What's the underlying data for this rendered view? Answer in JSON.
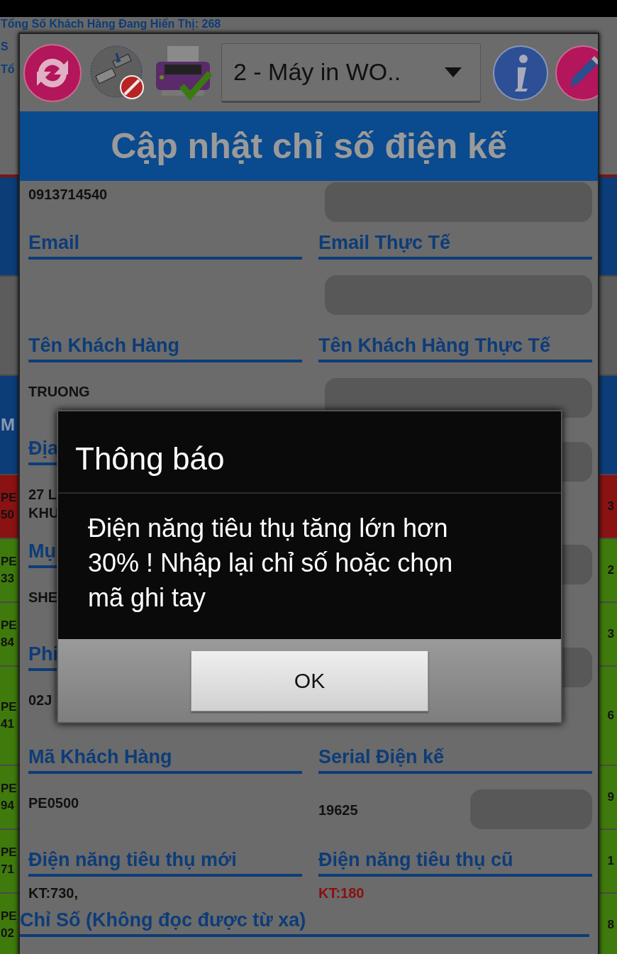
{
  "header": {
    "lines": [
      "Tổng Số Khách Hàng Đang Hiển Thị: 268",
      "S",
      "Tổ"
    ]
  },
  "background_rows": [
    {
      "kind": "tall",
      "color": "#0c3d78"
    },
    {
      "kind": "tall",
      "color": "#5c5c5c"
    },
    {
      "kind": "tall",
      "color": "#0c3d78",
      "lines": [
        "M"
      ]
    },
    {
      "kind": "item",
      "color": "#8a1212",
      "lines": [
        "PE",
        "50"
      ],
      "end": "3"
    },
    {
      "kind": "item",
      "color": "#3f7a0c",
      "lines": [
        "PE",
        "33"
      ],
      "end": "2"
    },
    {
      "kind": "item",
      "color": "#3f7a0c",
      "lines": [
        "PE",
        "84"
      ],
      "end": "3"
    },
    {
      "kind": "tall",
      "color": "#3f7a0c",
      "lines": [
        "PE",
        "41"
      ],
      "end": "6"
    },
    {
      "kind": "item",
      "color": "#3f7a0c",
      "lines": [
        "PE",
        "94"
      ],
      "end": "9"
    },
    {
      "kind": "item",
      "color": "#3f7a0c",
      "lines": [
        "PE",
        "71"
      ],
      "end": "1"
    },
    {
      "kind": "item",
      "color": "#3f7a0c",
      "lines": [
        "PE",
        "02"
      ],
      "end": "8"
    }
  ],
  "toolbar": {
    "printer_select": {
      "value": "2 - Máy in WO.."
    }
  },
  "form": {
    "title": "Cập nhật chỉ số điện kế",
    "rows": [
      {
        "kind": "pair",
        "left": {
          "lines": [
            "0913714540"
          ]
        },
        "right": {
          "box": true
        }
      },
      {
        "kind": "pair",
        "left": {
          "label": "Email"
        },
        "right": {
          "label": "Email Thực Tế",
          "box": true
        }
      },
      {
        "kind": "pair",
        "left": {
          "label": "Tên Khách Hàng",
          "lines": [
            "TRUONG"
          ]
        },
        "right": {
          "label": "Tên Khách Hàng Thực Tế",
          "box": true
        }
      },
      {
        "kind": "pair",
        "left": {
          "label": "Địa",
          "lines": [
            "27 L",
            "KHU"
          ]
        },
        "right": {
          "box": true
        }
      },
      {
        "kind": "pair",
        "left": {
          "label": "Mụ",
          "lines": [
            "SHE"
          ]
        },
        "right": {
          "box": true
        }
      },
      {
        "kind": "pair",
        "left": {
          "label": "Phi",
          "lines": [
            "02J"
          ]
        },
        "right": {
          "box": true
        }
      },
      {
        "kind": "pair",
        "left": {
          "label": "Mã Khách Hàng",
          "lines": [
            "PE0500"
          ]
        },
        "right": {
          "label": "Serial Điện kế",
          "lines": [
            "19625"
          ],
          "box": true
        }
      },
      {
        "kind": "short",
        "left": {
          "label": "Điện năng tiêu thụ mới",
          "lines": [
            "KT:730,"
          ]
        },
        "right": {
          "label": "Điện năng tiêu thụ cũ",
          "lines": [
            "KT:180"
          ],
          "alert": true
        }
      },
      {
        "kind": "wide",
        "left": {
          "label": "Chỉ Số (Không đọc được từ xa)"
        }
      }
    ]
  },
  "dialog": {
    "title": "Thông báo",
    "message": "Điện năng tiêu thụ tăng lớn hơn 30% ! Nhập lại chỉ số hoặc chọn mã ghi tay",
    "button": "OK"
  }
}
